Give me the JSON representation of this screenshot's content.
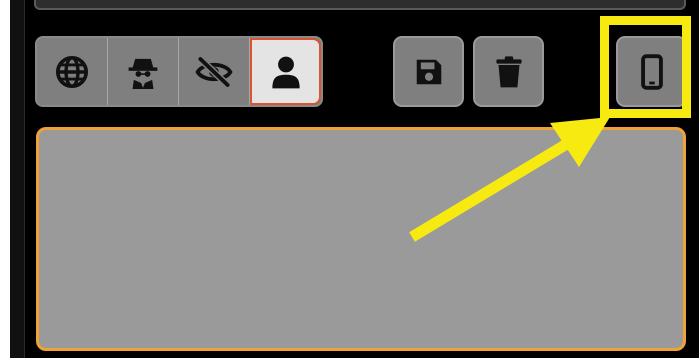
{
  "toolbar": {
    "mode_group": [
      {
        "icon": "globe-icon",
        "active": false
      },
      {
        "icon": "spy-icon",
        "active": false
      },
      {
        "icon": "eye-slash-icon",
        "active": false
      },
      {
        "icon": "user-icon",
        "active": true
      }
    ],
    "actions": [
      {
        "icon": "save-icon"
      },
      {
        "icon": "trash-icon"
      },
      {
        "icon": "mobile-device-icon"
      }
    ]
  },
  "annotation": {
    "highlight_color": "#f7ea11",
    "target": "mobile-device-button"
  },
  "colors": {
    "background": "#000000",
    "content_area": "#9a9a9a",
    "content_border": "#f0a238",
    "active_border": "#d8552f"
  }
}
